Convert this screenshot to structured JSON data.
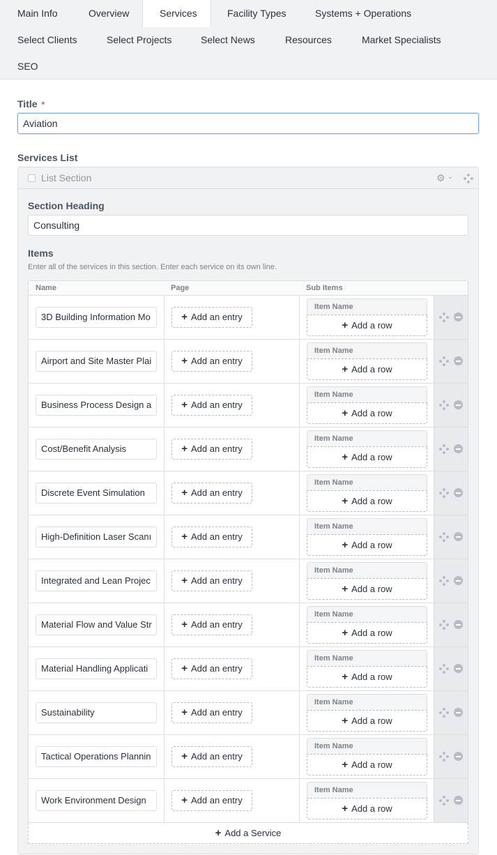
{
  "tabs": [
    {
      "label": "Main Info"
    },
    {
      "label": "Overview"
    },
    {
      "label": "Services"
    },
    {
      "label": "Facility Types"
    },
    {
      "label": "Systems + Operations"
    },
    {
      "label": "Select Clients"
    },
    {
      "label": "Select Projects"
    },
    {
      "label": "Select News"
    },
    {
      "label": "Resources"
    },
    {
      "label": "Market Specialists"
    },
    {
      "label": "SEO"
    }
  ],
  "active_tab": "Services",
  "title_field": {
    "label": "Title",
    "required_mark": "*",
    "value": "Aviation"
  },
  "services_list": {
    "label": "Services List",
    "block_title": "List Section",
    "section_heading_label": "Section Heading",
    "section_heading_value": "Consulting",
    "items_label": "Items",
    "items_hint": "Enter all of the services in this section. Enter each service on its own line.",
    "columns": {
      "name": "Name",
      "page": "Page",
      "sub_items": "Sub Items"
    },
    "add_entry_label": "Add an entry",
    "sub_item_header": "Item Name",
    "add_row_label": "Add a row",
    "add_service_label": "Add a Service",
    "rows": [
      {
        "name": "3D Building Information Mo"
      },
      {
        "name": "Airport and Site Master Plai"
      },
      {
        "name": "Business Process Design a"
      },
      {
        "name": "Cost/Benefit Analysis"
      },
      {
        "name": "Discrete Event Simulation"
      },
      {
        "name": "High-Definition Laser Scanı"
      },
      {
        "name": "Integrated and Lean Projec"
      },
      {
        "name": "Material Flow and Value Str"
      },
      {
        "name": "Material Handling Applicati"
      },
      {
        "name": "Sustainability"
      },
      {
        "name": "Tactical Operations Plannin"
      },
      {
        "name": "Work Environment Design"
      }
    ]
  }
}
